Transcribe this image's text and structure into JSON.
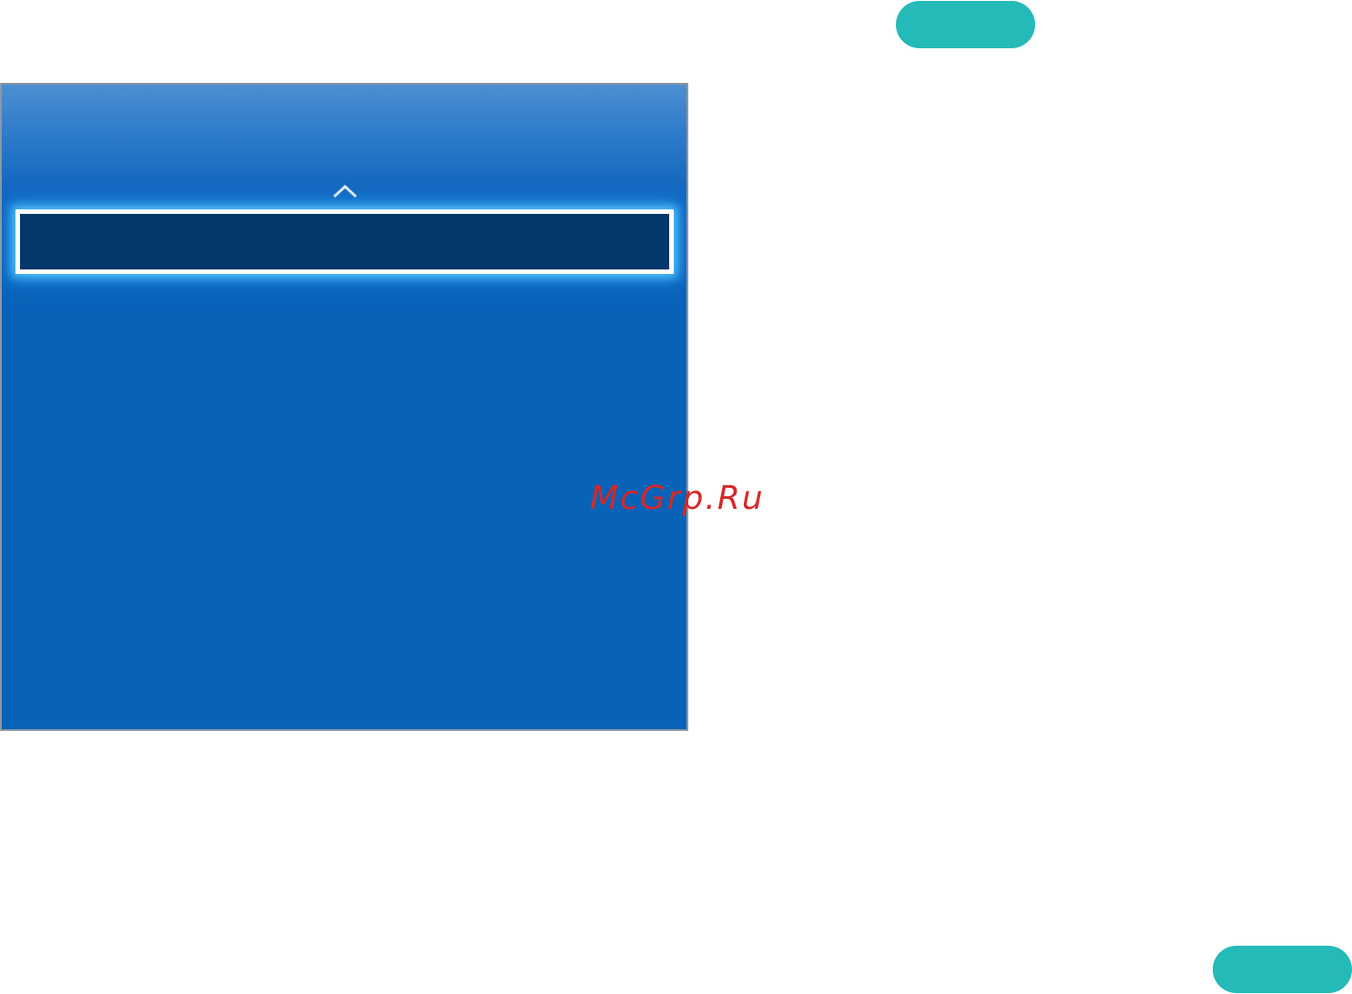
{
  "menu": {
    "scroll_up_icon": "chevron-up-icon",
    "selected_item_label": ""
  },
  "watermark": {
    "text": "McGrp.Ru"
  },
  "colors": {
    "pill": "#24bab8",
    "panel": "#0862b8",
    "selected_row": "#04376a",
    "focus_glow": "#5ac8ff",
    "watermark": "#d62828"
  }
}
